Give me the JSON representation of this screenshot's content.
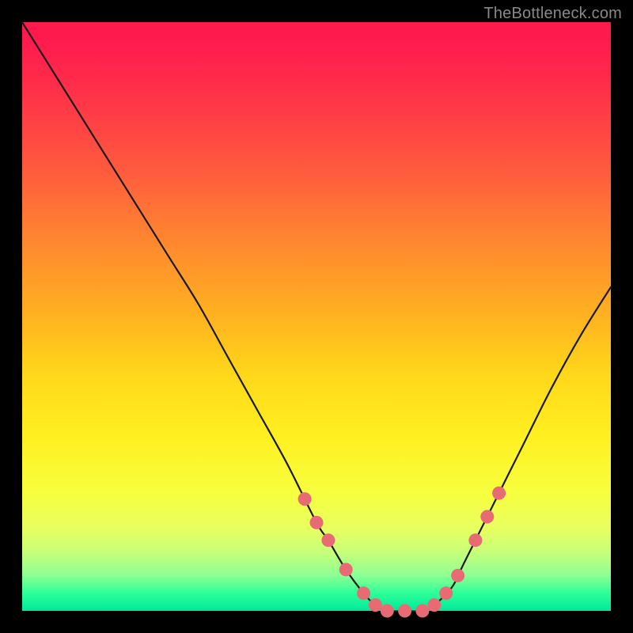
{
  "watermark": "TheBottleneck.com",
  "colors": {
    "background": "#000000",
    "curve_stroke": "#1a1a1a",
    "dot_fill": "#e86b74",
    "gradient_top": "#ff1a4e",
    "gradient_bottom": "#00e89a"
  },
  "chart_data": {
    "type": "line",
    "title": "",
    "xlabel": "",
    "ylabel": "",
    "xlim": [
      0,
      100
    ],
    "ylim": [
      0,
      100
    ],
    "legend": false,
    "grid": false,
    "series": [
      {
        "name": "bottleneck-curve",
        "x": [
          0,
          5,
          10,
          15,
          20,
          25,
          30,
          35,
          40,
          45,
          50,
          52,
          55,
          58,
          60,
          62,
          65,
          68,
          70,
          73,
          75,
          80,
          85,
          90,
          95,
          100
        ],
        "y": [
          100,
          92,
          84,
          76,
          68,
          60,
          52,
          43,
          34,
          25,
          15,
          12,
          7,
          3,
          1,
          0,
          0,
          0,
          1,
          4,
          8,
          18,
          28,
          38,
          47,
          55
        ]
      }
    ],
    "dots": {
      "name": "highlighted-range",
      "x": [
        48,
        50,
        52,
        55,
        58,
        60,
        62,
        65,
        68,
        70,
        72,
        74,
        77,
        79,
        81
      ],
      "y": [
        19,
        15,
        12,
        7,
        3,
        1,
        0,
        0,
        0,
        1,
        3,
        6,
        12,
        16,
        20
      ]
    }
  }
}
